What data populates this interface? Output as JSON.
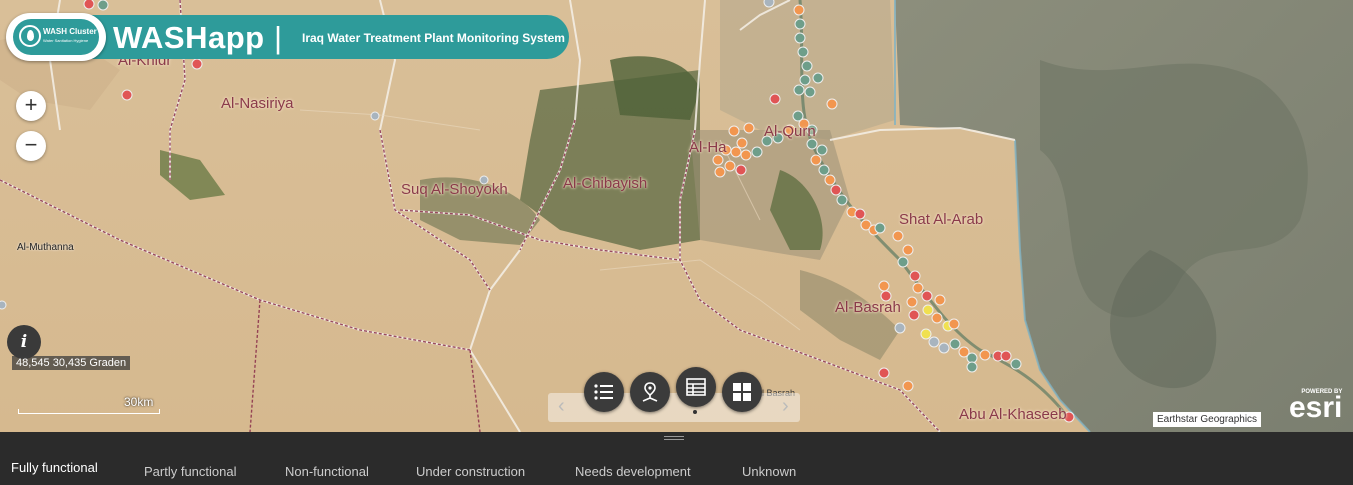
{
  "header": {
    "logo_title": "WASH Cluster",
    "logo_subtitle": "Water Sanitation Hygiene",
    "app_name": "WASHapp",
    "separator": "|",
    "app_subtitle": "Iraq Water Treatment Plant Monitoring System"
  },
  "map": {
    "places": [
      {
        "id": "al-nasiriya",
        "label": "Al-Nasiriya"
      },
      {
        "id": "suq-al-shoyokh",
        "label": "Suq Al-Shoyokh"
      },
      {
        "id": "al-chibayish",
        "label": "Al-Chibayish"
      },
      {
        "id": "shat-al-arab",
        "label": "Shat Al-Arab"
      },
      {
        "id": "al-basrah",
        "label": "Al-Basrah"
      },
      {
        "id": "abu-al-khaseeb",
        "label": "Abu Al-Khaseeb"
      },
      {
        "id": "al-muthanna",
        "label": "Al-Muthanna"
      },
      {
        "id": "al-khidr",
        "label": "Al-Khidr"
      },
      {
        "id": "al-hartha",
        "label": "Al-Ha"
      },
      {
        "id": "al-qurna",
        "label": "Al-Qurn"
      }
    ],
    "basrah_partial": "l Basrah",
    "coordinates": "48,545 30,435 Graden",
    "scale_label": "30km",
    "attribution": "Earthstar Geographics",
    "esri_powered": "POWERED BY",
    "esri_logo": "esri",
    "status_colors": {
      "fully_functional": "#6e9e8a",
      "partly_functional": "#f2964f",
      "non_functional": "#e05555",
      "under_construction": "#f0e050",
      "unknown": "#a8b4be"
    }
  },
  "controls": {
    "zoom_in": "+",
    "zoom_out": "−",
    "info": "i",
    "widgets": [
      {
        "id": "legend",
        "icon": "list-icon"
      },
      {
        "id": "nearby",
        "icon": "map-pin-network-icon"
      },
      {
        "id": "table",
        "icon": "table-icon"
      },
      {
        "id": "grid",
        "icon": "grid-icon"
      }
    ],
    "prev_arrow": "‹",
    "next_arrow": "›"
  },
  "legend_tabs": [
    {
      "label": "Fully functional",
      "active": true
    },
    {
      "label": "Partly functional",
      "active": false
    },
    {
      "label": "Non-functional",
      "active": false
    },
    {
      "label": "Under construction",
      "active": false
    },
    {
      "label": "Needs development",
      "active": false
    },
    {
      "label": "Unknown",
      "active": false
    }
  ]
}
